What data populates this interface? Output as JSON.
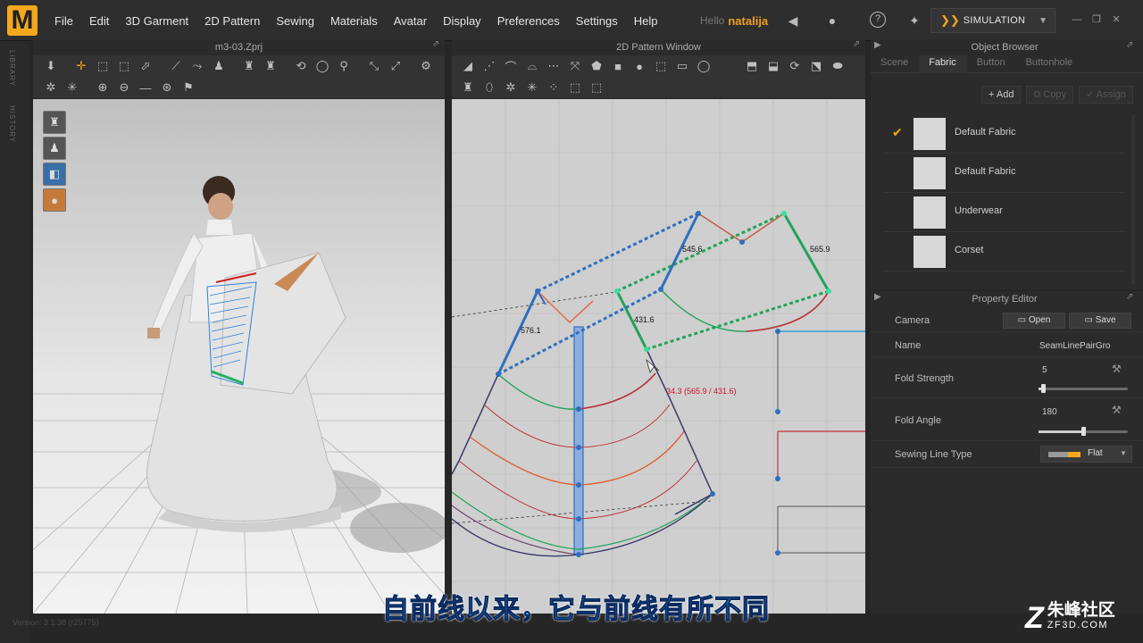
{
  "app": {
    "logo": "M"
  },
  "menu": [
    "File",
    "Edit",
    "3D Garment",
    "2D Pattern",
    "Sewing",
    "Materials",
    "Avatar",
    "Display",
    "Preferences",
    "Settings",
    "Help"
  ],
  "user": {
    "greeting": "Hello",
    "name": "natalija"
  },
  "simulation": {
    "label": "SIMULATION"
  },
  "left_strip": {
    "library": "LIBRARY",
    "history": "HISTORY"
  },
  "panel3d": {
    "title": "m3-03.Zprj"
  },
  "panel2d": {
    "title": "2D Pattern Window",
    "measurements": {
      "m1": "545.6",
      "m2": "565.9",
      "m3": "431.6",
      "m4": "576.1",
      "red": "34.3 (565.9 / 431.6)"
    }
  },
  "object_browser": {
    "title": "Object Browser",
    "tabs": [
      "Scene",
      "Fabric",
      "Button",
      "Buttonhole"
    ],
    "active_tab": "Fabric",
    "actions": {
      "add": "Add",
      "copy": "Copy",
      "assign": "Assign"
    },
    "fabrics": [
      "Default Fabric",
      "Default Fabric",
      "Underwear",
      "Corset"
    ]
  },
  "property_editor": {
    "title": "Property Editor",
    "camera_label": "Camera",
    "open": "Open",
    "save": "Save",
    "name_label": "Name",
    "name_value": "SeamLinePairGro",
    "fold_strength_label": "Fold Strength",
    "fold_strength_value": "5",
    "fold_strength_fraction": 0.05,
    "fold_angle_label": "Fold Angle",
    "fold_angle_value": "180",
    "fold_angle_fraction": 0.5,
    "sewing_line_type_label": "Sewing Line Type",
    "sewing_line_type_value": "Flat"
  },
  "status": {
    "version": "Version: 3.1.38 (r25775)"
  },
  "subtitle": "自前线以来，它与前线有所不同",
  "watermark": {
    "cn": "朱峰社区",
    "url": "ZF3D.COM"
  },
  "colors": {
    "accent": "#f4a81d",
    "seam_blue": "#2f6fbf",
    "seam_green": "#1fa35a",
    "line_red": "#c0303a"
  }
}
